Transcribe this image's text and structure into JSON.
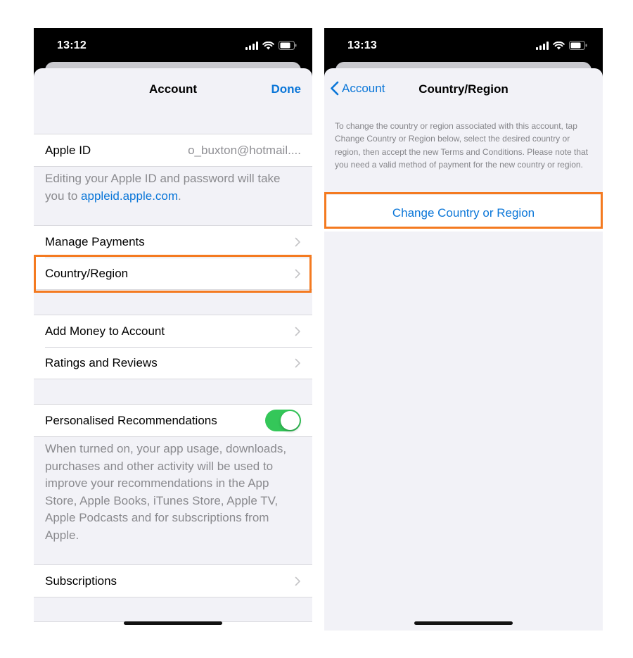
{
  "left_screen": {
    "status_time": "13:12",
    "nav": {
      "title": "Account",
      "done_label": "Done"
    },
    "apple_id": {
      "label": "Apple ID",
      "value": "o_buxton@hotmail...."
    },
    "apple_id_note": {
      "text": "Editing your Apple ID and password will take you to ",
      "link": "appleid.apple.com",
      "suffix": "."
    },
    "payments_group": [
      {
        "label": "Manage Payments"
      },
      {
        "label": "Country/Region"
      }
    ],
    "money_group": [
      {
        "label": "Add Money to Account"
      },
      {
        "label": "Ratings and Reviews"
      }
    ],
    "recommendations": {
      "label": "Personalised Recommendations",
      "enabled": true,
      "note": "When turned on, your app usage, downloads, purchases and other activity will be used to improve your recommendations in the App Store, Apple Books, iTunes Store, Apple TV, Apple Podcasts and for subscriptions from Apple."
    },
    "subscriptions": {
      "label": "Subscriptions"
    }
  },
  "right_screen": {
    "status_time": "13:13",
    "nav": {
      "back_label": "Account",
      "title": "Country/Region"
    },
    "instructions": "To change the country or region associated with this account, tap Change Country or Region below, select the desired country or region, then accept the new Terms and Conditions. Please note that you need a valid method of payment for the new country or region.",
    "change_button_label": "Change Country or Region"
  },
  "colors": {
    "accent": "#0a76d8",
    "highlight": "#f47a20",
    "toggle_on": "#34c759",
    "background": "#f2f2f7"
  }
}
